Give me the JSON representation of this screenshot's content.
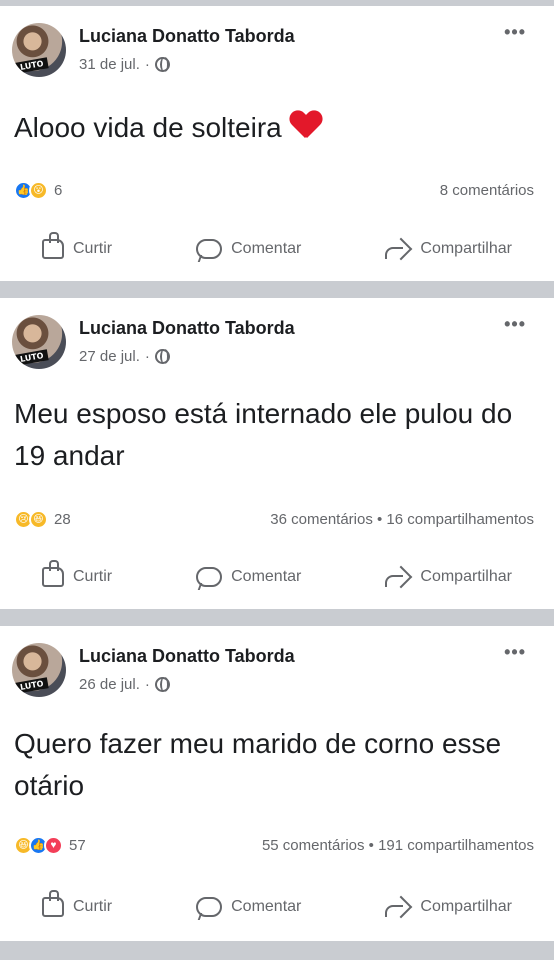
{
  "colors": {
    "background": "#ffffff",
    "divider": "#c9ccd1",
    "text": "#1c1e21",
    "muted": "#65676b",
    "like_blue": "#1877f2",
    "heart_red": "#e3182a"
  },
  "actions": {
    "like_label": "Curtir",
    "comment_label": "Comentar",
    "share_label": "Compartilhar"
  },
  "posts": [
    {
      "author": "Luciana Donatto Taborda",
      "date": "31 de jul.",
      "separator": "·",
      "text": "Alooo vida de solteira",
      "emoji": "red-heart",
      "reactions": [
        "like",
        "wow"
      ],
      "reaction_count": "6",
      "stats_right": "8 comentários"
    },
    {
      "author": "Luciana Donatto Taborda",
      "date": "27 de jul.",
      "separator": "·",
      "text": "Meu esposo está internado ele pulou do 19 andar",
      "reactions": [
        "sad",
        "haha"
      ],
      "reaction_count": "28",
      "stats_right": "36 comentários • 16 compartilhamentos"
    },
    {
      "author": "Luciana Donatto Taborda",
      "date": "26 de jul.",
      "separator": "·",
      "text": "Quero fazer meu marido de corno esse otário",
      "reactions": [
        "haha",
        "like",
        "love"
      ],
      "reaction_count": "57",
      "stats_right": "55 comentários • 191 compartilhamentos"
    }
  ]
}
